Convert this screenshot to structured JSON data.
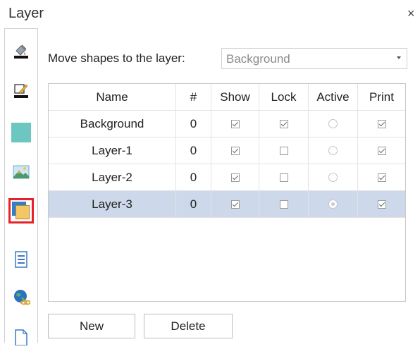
{
  "dialog": {
    "title": "Layer",
    "close_glyph": "×"
  },
  "toolbar": {
    "items": [
      {
        "icon": "fill-color-icon"
      },
      {
        "icon": "line-style-icon"
      },
      {
        "icon": "shape-fill-icon"
      },
      {
        "icon": "picture-icon"
      },
      {
        "icon": "layer-icon",
        "selected": true
      },
      {
        "icon": "page-list-icon"
      },
      {
        "icon": "globe-link-icon"
      },
      {
        "icon": "document-icon"
      }
    ]
  },
  "move": {
    "label": "Move shapes to the layer:",
    "selected": "Background"
  },
  "table": {
    "columns": [
      "Name",
      "#",
      "Show",
      "Lock",
      "Active",
      "Print"
    ],
    "rows": [
      {
        "name": "Background",
        "count": "0",
        "show": true,
        "lock": true,
        "active": false,
        "print": true,
        "selected": false
      },
      {
        "name": "Layer-1",
        "count": "0",
        "show": true,
        "lock": false,
        "active": false,
        "print": true,
        "selected": false
      },
      {
        "name": "Layer-2",
        "count": "0",
        "show": true,
        "lock": false,
        "active": false,
        "print": true,
        "selected": false
      },
      {
        "name": "Layer-3",
        "count": "0",
        "show": true,
        "lock": false,
        "active": true,
        "print": true,
        "selected": true
      }
    ]
  },
  "buttons": {
    "new": "New",
    "delete": "Delete"
  }
}
